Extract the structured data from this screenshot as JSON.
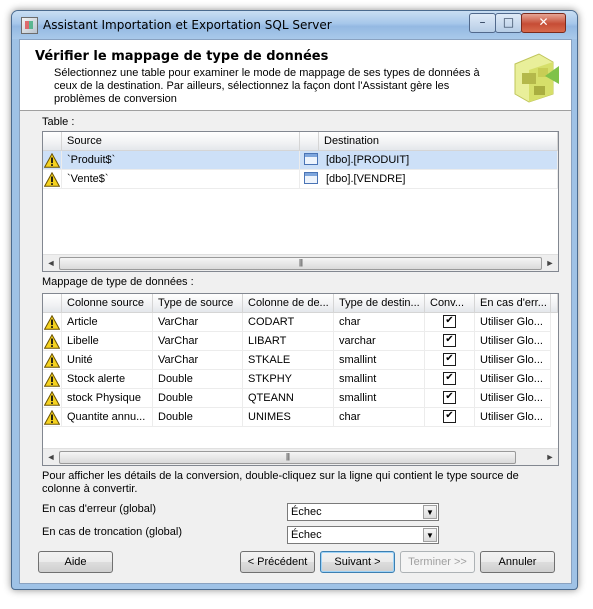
{
  "window": {
    "title": "Assistant Importation et Exportation SQL Server"
  },
  "header": {
    "title": "Vérifier le mappage de type de données",
    "description": "Sélectionnez une table pour examiner le mode de mappage de ses types de données à ceux de la destination. Par ailleurs, sélectionnez la façon dont l'Assistant gère les problèmes de conversion"
  },
  "table_section": {
    "label": "Table :",
    "columns": [
      "Source",
      "Destination"
    ],
    "rows": [
      {
        "source": "`Produit$`",
        "destination": "[dbo].[PRODUIT]",
        "selected": true
      },
      {
        "source": "`Vente$`",
        "destination": "[dbo].[VENDRE]",
        "selected": false
      }
    ]
  },
  "mapping_section": {
    "label": "Mappage de type de données :",
    "columns": [
      "Colonne source",
      "Type de source",
      "Colonne de de...",
      "Type de destin...",
      "Conv...",
      "En cas d'err..."
    ],
    "rows": [
      {
        "col": "Article",
        "src_type": "VarChar",
        "dest_col": "CODART",
        "dest_type": "char",
        "convert": "✔",
        "on_error": "Utiliser Glo..."
      },
      {
        "col": "Libelle",
        "src_type": "VarChar",
        "dest_col": "LIBART",
        "dest_type": "varchar",
        "convert": "✔",
        "on_error": "Utiliser Glo..."
      },
      {
        "col": "Unité",
        "src_type": "VarChar",
        "dest_col": "STKALE",
        "dest_type": "smallint",
        "convert": "✔",
        "on_error": "Utiliser Glo..."
      },
      {
        "col": "Stock alerte",
        "src_type": "Double",
        "dest_col": "STKPHY",
        "dest_type": "smallint",
        "convert": "✔",
        "on_error": "Utiliser Glo..."
      },
      {
        "col": "stock Physique",
        "src_type": "Double",
        "dest_col": "QTEANN",
        "dest_type": "smallint",
        "convert": "✔",
        "on_error": "Utiliser Glo..."
      },
      {
        "col": "Quantite annu...",
        "src_type": "Double",
        "dest_col": "UNIMES",
        "dest_type": "char",
        "convert": "✔",
        "on_error": "Utiliser Glo..."
      }
    ]
  },
  "info_text": "Pour afficher les détails de la conversion, double-cliquez sur la ligne qui contient le type source de colonne à convertir.",
  "error_global": {
    "label": "En cas d'erreur (global)",
    "value": "Échec"
  },
  "truncation_global": {
    "label": "En cas de troncation (global)",
    "value": "Échec"
  },
  "buttons": {
    "help": "Aide",
    "previous": "< Précédent",
    "next": "Suivant >",
    "finish": "Terminer >>",
    "cancel": "Annuler"
  },
  "scrollbar": {
    "arrow_left": "◄",
    "arrow_right": "►",
    "grip": "|||"
  },
  "dropdown_arrow": "▼",
  "window_buttons": {
    "minimize": "–",
    "maximize": "□",
    "close": "✕"
  },
  "icons": {
    "warning": "warning-icon",
    "table": "table-icon",
    "wizard": "wizard-graphic"
  },
  "colors": {
    "selection": "#cde0f7",
    "title_bar": "#a6c7ea",
    "warning": "#f5d21f"
  }
}
